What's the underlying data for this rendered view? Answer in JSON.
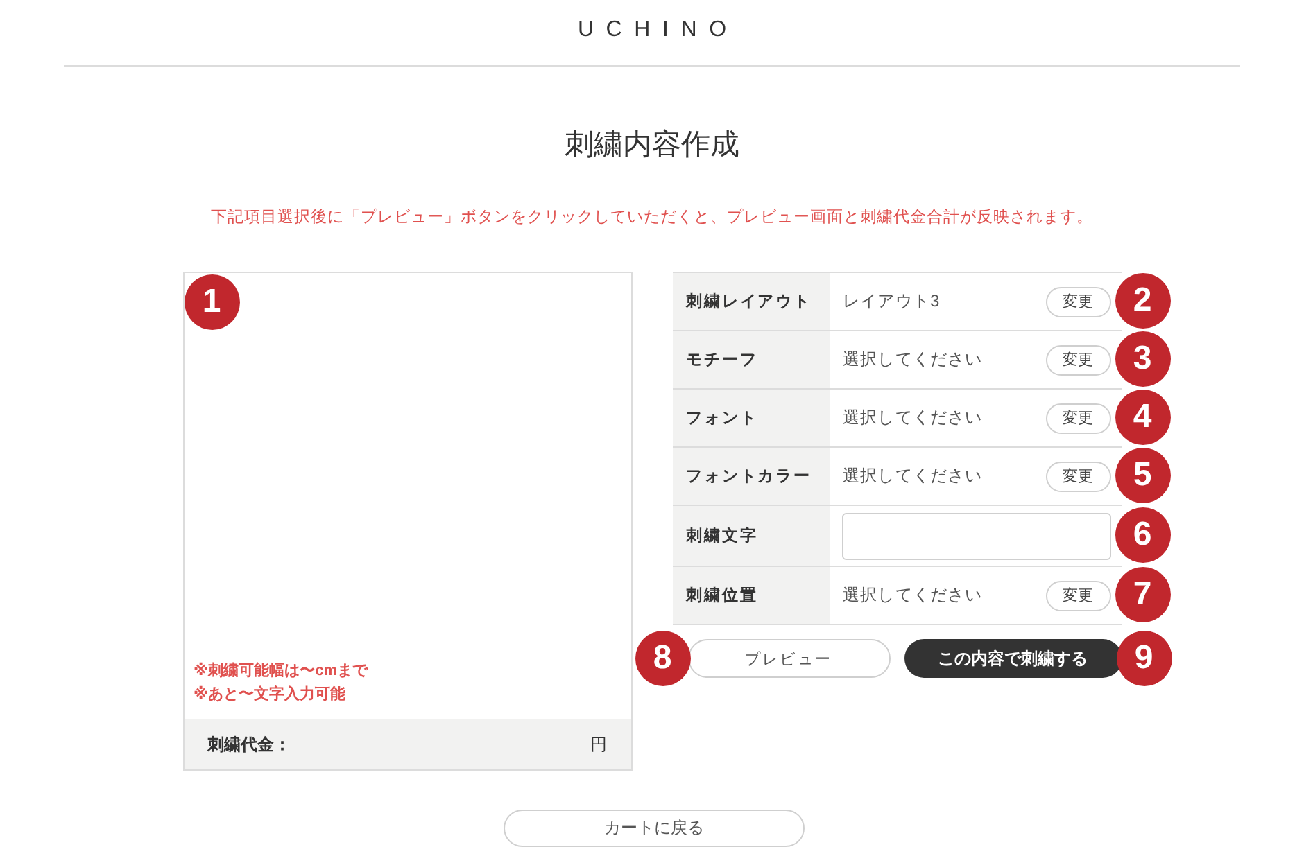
{
  "header": {
    "logo": "UCHINO"
  },
  "page": {
    "title": "刺繍内容作成",
    "notice": "下記項目選択後に「プレビュー」ボタンをクリックしていただくと、プレビュー画面と刺繍代金合計が反映されます。"
  },
  "preview": {
    "marker": "1",
    "notes": [
      "※刺繍可能幅は〜cmまで",
      "※あと〜文字入力可能"
    ],
    "price_label": "刺繍代金：",
    "price_unit": "円"
  },
  "options": [
    {
      "kind": "select",
      "label": "刺繍レイアウト",
      "value": "レイアウト3",
      "button": "変更",
      "marker": "2"
    },
    {
      "kind": "select",
      "label": "モチーフ",
      "value": "選択してください",
      "button": "変更",
      "marker": "3"
    },
    {
      "kind": "select",
      "label": "フォント",
      "value": "選択してください",
      "button": "変更",
      "marker": "4"
    },
    {
      "kind": "select",
      "label": "フォントカラー",
      "value": "選択してください",
      "button": "変更",
      "marker": "5"
    },
    {
      "kind": "text",
      "label": "刺繍文字",
      "marker": "6"
    },
    {
      "kind": "select",
      "label": "刺繍位置",
      "value": "選択してください",
      "button": "変更",
      "marker": "7"
    }
  ],
  "actions": [
    {
      "kind": "secondary",
      "label": "プレビュー",
      "marker": "8"
    },
    {
      "kind": "primary",
      "label": "この内容で刺繍する",
      "marker": "9"
    }
  ],
  "back_button": "カートに戻る"
}
